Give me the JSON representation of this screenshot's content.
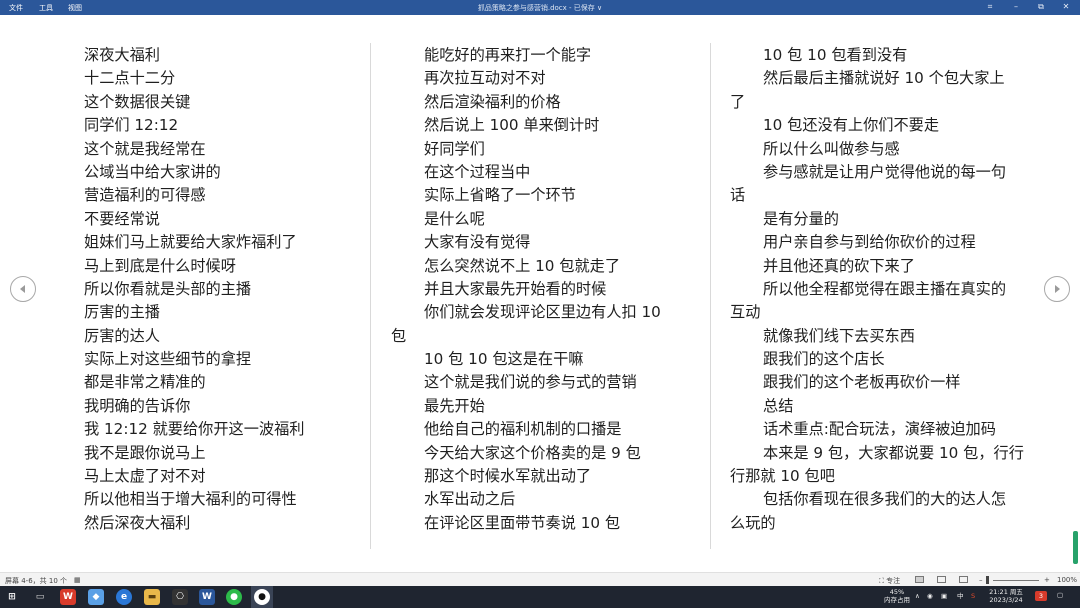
{
  "titlebar": {
    "menu": [
      "文件",
      "工具",
      "视图"
    ],
    "doc_title": "抓品策略之参与感营销.docx - 已保存 ∨"
  },
  "columns": [
    [
      {
        "t": "深夜大福利",
        "cont": false
      },
      {
        "t": "十二点十二分",
        "cont": false
      },
      {
        "t": "这个数据很关键",
        "cont": false
      },
      {
        "t": "同学们  12:12",
        "cont": false
      },
      {
        "t": "这个就是我经常在",
        "cont": false
      },
      {
        "t": "公域当中给大家讲的",
        "cont": false
      },
      {
        "t": "营造福利的可得感",
        "cont": false
      },
      {
        "t": "不要经常说",
        "cont": false
      },
      {
        "t": "姐妹们马上就要给大家炸福利了",
        "cont": false
      },
      {
        "t": "马上到底是什么时候呀",
        "cont": false
      },
      {
        "t": "所以你看就是头部的主播",
        "cont": false
      },
      {
        "t": "厉害的主播",
        "cont": false
      },
      {
        "t": "厉害的达人",
        "cont": false
      },
      {
        "t": "实际上对这些细节的拿捏",
        "cont": false
      },
      {
        "t": "都是非常之精准的",
        "cont": false
      },
      {
        "t": "我明确的告诉你",
        "cont": false
      },
      {
        "t": "我 12:12 就要给你开这一波福利",
        "cont": false
      },
      {
        "t": "我不是跟你说马上",
        "cont": false
      },
      {
        "t": "马上太虚了对不对",
        "cont": false
      },
      {
        "t": "所以他相当于增大福利的可得性",
        "cont": false
      },
      {
        "t": "然后深夜大福利",
        "cont": false
      }
    ],
    [
      {
        "t": "能吃好的再来打一个能字",
        "cont": false
      },
      {
        "t": "再次拉互动对不对",
        "cont": false
      },
      {
        "t": "然后渲染福利的价格",
        "cont": false
      },
      {
        "t": "然后说上 100 单来倒计时",
        "cont": false
      },
      {
        "t": "好同学们",
        "cont": false
      },
      {
        "t": "在这个过程当中",
        "cont": false
      },
      {
        "t": "实际上省略了一个环节",
        "cont": false
      },
      {
        "t": "是什么呢",
        "cont": false
      },
      {
        "t": "大家有没有觉得",
        "cont": false
      },
      {
        "t": "怎么突然说不上 10 包就走了",
        "cont": false
      },
      {
        "t": "并且大家最先开始看的时候",
        "cont": false
      },
      {
        "t": "你们就会发现评论区里边有人扣  10",
        "cont": false
      },
      {
        "t": "包",
        "cont": true
      },
      {
        "t": "10 包 10 包这是在干嘛",
        "cont": false
      },
      {
        "t": "这个就是我们说的参与式的营销",
        "cont": false
      },
      {
        "t": "最先开始",
        "cont": false
      },
      {
        "t": "他给自己的福利机制的口播是",
        "cont": false
      },
      {
        "t": "今天给大家这个价格卖的是 9 包",
        "cont": false
      },
      {
        "t": "那这个时候水军就出动了",
        "cont": false
      },
      {
        "t": "水军出动之后",
        "cont": false
      },
      {
        "t": "在评论区里面带节奏说 10 包",
        "cont": false
      }
    ],
    [
      {
        "t": "10 包 10 包看到没有",
        "cont": false
      },
      {
        "t": "然后最后主播就说好  10  个包大家上",
        "cont": false
      },
      {
        "t": "了",
        "cont": true
      },
      {
        "t": "10 包还没有上你们不要走",
        "cont": false
      },
      {
        "t": "所以什么叫做参与感",
        "cont": false
      },
      {
        "t": "参与感就是让用户觉得他说的每一句",
        "cont": false
      },
      {
        "t": "话",
        "cont": true
      },
      {
        "t": "是有分量的",
        "cont": false
      },
      {
        "t": "用户亲自参与到给你砍价的过程",
        "cont": false
      },
      {
        "t": "并且他还真的砍下来了",
        "cont": false
      },
      {
        "t": "所以他全程都觉得在跟主播在真实的",
        "cont": false
      },
      {
        "t": "互动",
        "cont": true
      },
      {
        "t": "就像我们线下去买东西",
        "cont": false
      },
      {
        "t": "跟我们的这个店长",
        "cont": false
      },
      {
        "t": "跟我们的这个老板再砍价一样",
        "cont": false
      },
      {
        "t": "总结",
        "cont": false
      },
      {
        "t": "话术重点:配合玩法，演绎被迫加码",
        "cont": false
      },
      {
        "t": "本来是 9 包，大家都说要 10 包，行行",
        "cont": false
      },
      {
        "t": "行那就 10 包吧",
        "cont": true
      },
      {
        "t": "包括你看现在很多我们的大的达人怎",
        "cont": false
      },
      {
        "t": "么玩的",
        "cont": true
      }
    ]
  ],
  "statusbar": {
    "page_info": "屏幕 4-6，共 10 个",
    "focus": "专注",
    "zoom": "100%"
  },
  "taskbar": {
    "memory_pct": "45%",
    "memory_label": "内存占用",
    "ime": "中",
    "time": "21:21 周五",
    "date": "2023/3/24",
    "badge": "3"
  },
  "icons": {
    "prev": "chevron-left-icon",
    "next": "chevron-right-icon"
  }
}
